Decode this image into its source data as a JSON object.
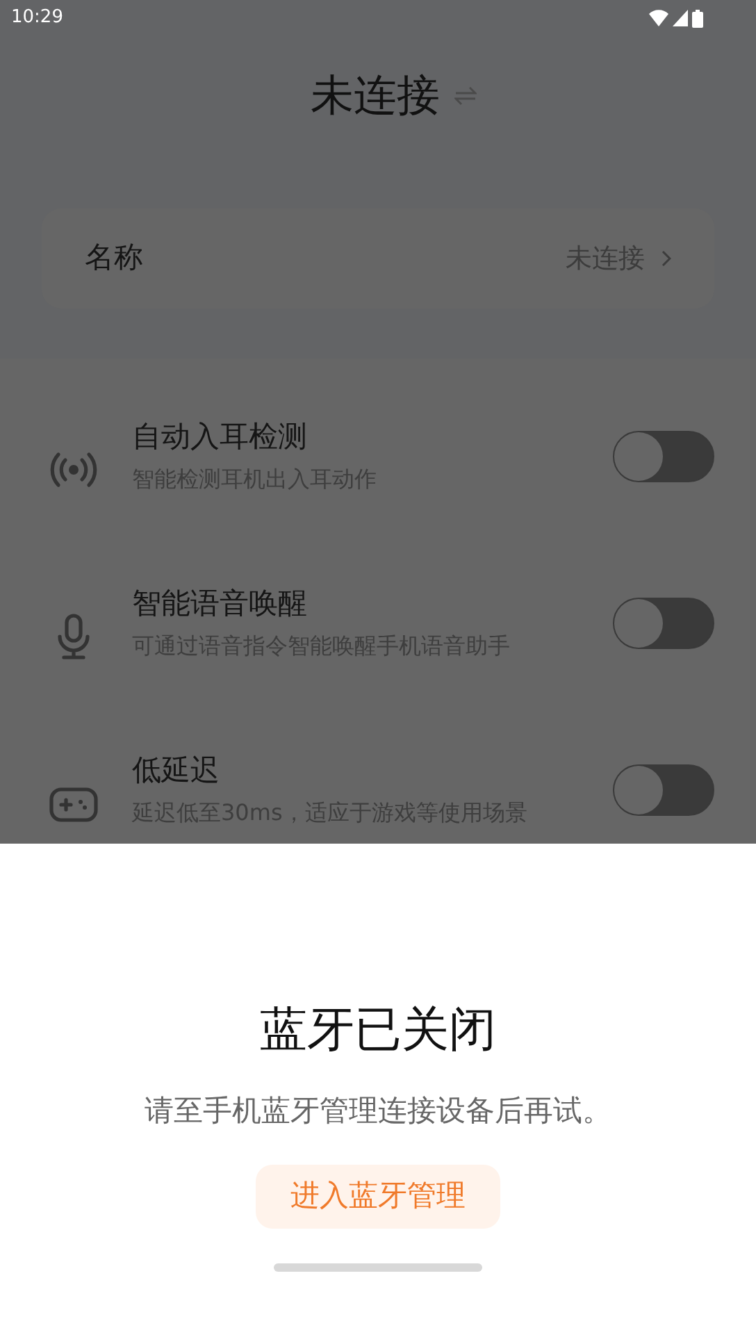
{
  "status_bar": {
    "time": "10:29"
  },
  "header": {
    "title": "未连接"
  },
  "name_row": {
    "label": "名称",
    "value": "未连接"
  },
  "settings": [
    {
      "kind": "signal",
      "title": "自动入耳检测",
      "subtitle": "智能检测耳机出入耳动作",
      "on": false
    },
    {
      "kind": "mic",
      "title": "智能语音唤醒",
      "subtitle": "可通过语音指令智能唤醒手机语音助手",
      "on": false
    },
    {
      "kind": "gamepad",
      "title": "低延迟",
      "subtitle": "延迟低至30ms，适应于游戏等使用场景",
      "on": false
    }
  ],
  "sheet": {
    "title": "蓝牙已关闭",
    "message": "请至手机蓝牙管理连接设备后再试。",
    "button": "进入蓝牙管理"
  }
}
